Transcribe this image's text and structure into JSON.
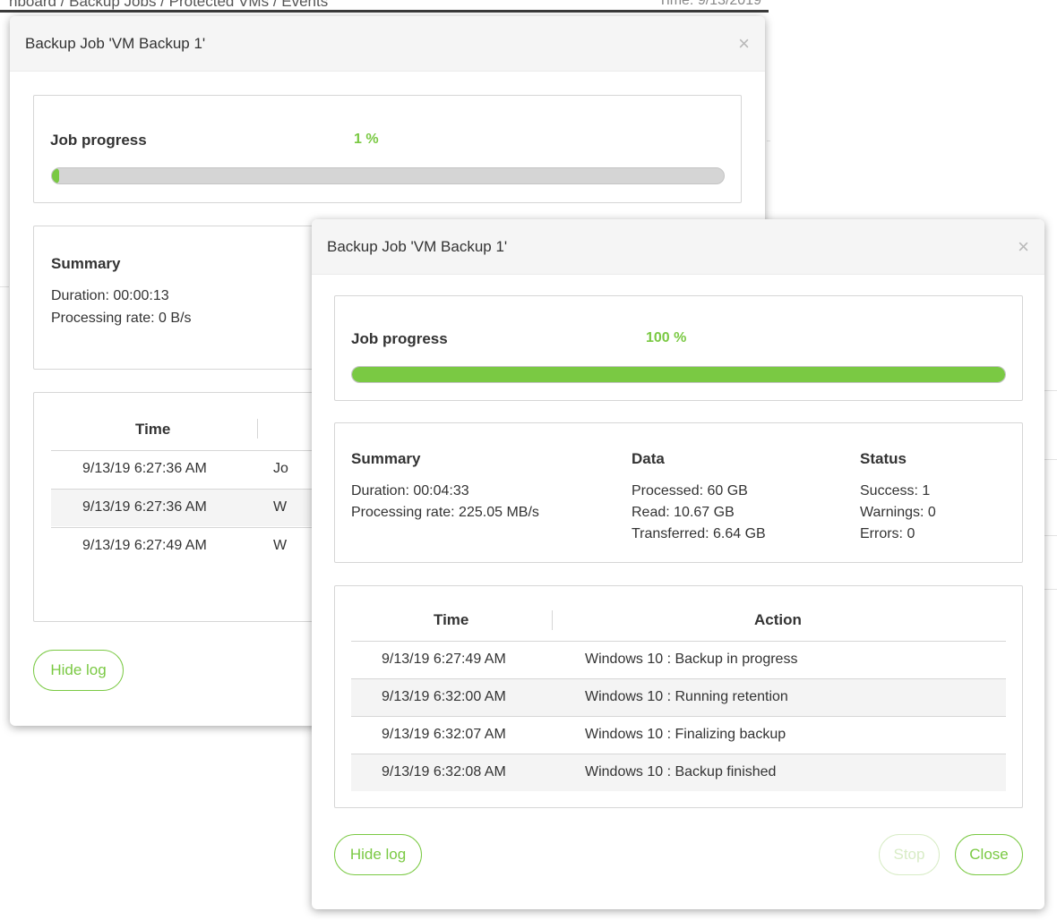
{
  "background": {
    "breadcrumb": "hboard / Backup Jobs / Protected VMs / Events",
    "time": "Time: 9/13/2019"
  },
  "dialog_back": {
    "title": "Backup Job 'VM Backup 1'",
    "close_glyph": "×",
    "progress": {
      "label": "Job progress",
      "percent_text": "1 %",
      "value": 0.01
    },
    "summary": {
      "title": "Summary",
      "duration": "Duration: 00:00:13",
      "rate": "Processing rate: 0 B/s"
    },
    "log": {
      "col_time": "Time",
      "rows": [
        {
          "time": "9/13/19 6:27:36 AM",
          "action": "Jo"
        },
        {
          "time": "9/13/19 6:27:36 AM",
          "action": "W"
        },
        {
          "time": "9/13/19 6:27:49 AM",
          "action": "W"
        }
      ]
    },
    "hide_log": "Hide log"
  },
  "dialog_front": {
    "title": "Backup Job 'VM Backup 1'",
    "close_glyph": "×",
    "progress": {
      "label": "Job progress",
      "percent_text": "100 %",
      "value": 1.0
    },
    "summary": {
      "title": "Summary",
      "duration": "Duration: 00:04:33",
      "rate": "Processing rate: 225.05 MB/s"
    },
    "data": {
      "title": "Data",
      "processed": "Processed: 60 GB",
      "read": "Read: 10.67 GB",
      "transferred": "Transferred: 6.64 GB"
    },
    "status": {
      "title": "Status",
      "success": "Success: 1",
      "warnings": "Warnings: 0",
      "errors": "Errors: 0"
    },
    "log": {
      "col_time": "Time",
      "col_action": "Action",
      "rows": [
        {
          "time": "9/13/19 6:27:49 AM",
          "action": "Windows 10 : Backup in progress"
        },
        {
          "time": "9/13/19 6:32:00 AM",
          "action": "Windows 10 : Running retention"
        },
        {
          "time": "9/13/19 6:32:07 AM",
          "action": "Windows 10 : Finalizing backup"
        },
        {
          "time": "9/13/19 6:32:08 AM",
          "action": "Windows 10 : Backup finished"
        }
      ]
    },
    "hide_log": "Hide log",
    "stop": "Stop",
    "close": "Close"
  },
  "colors": {
    "accent": "#7ac943",
    "accent_disabled": "#d8ecc6",
    "track": "#d5d5d5"
  }
}
